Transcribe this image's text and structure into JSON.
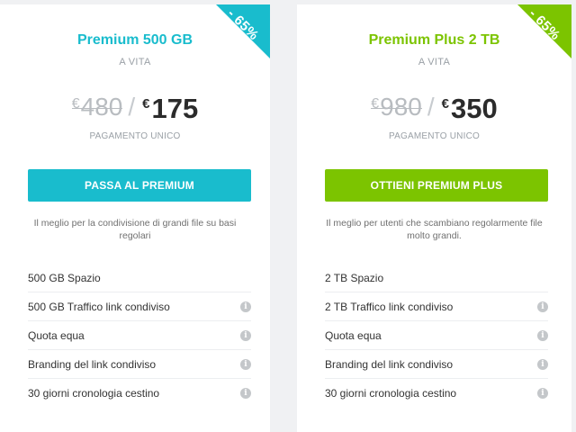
{
  "plans": [
    {
      "title": "Premium 500 GB",
      "subtitle": "A VITA",
      "discount": "- 65%",
      "old_price_currency": "€",
      "old_price": "480",
      "new_price_currency": "€",
      "new_price": "175",
      "payment_label": "PAGAMENTO UNICO",
      "cta_label": "PASSA AL PREMIUM",
      "description": "Il meglio per la condivisione di grandi file su basi regolari",
      "accent_color": "#19bccd",
      "features": [
        {
          "label": "500 GB Spazio",
          "info": false
        },
        {
          "label": "500 GB Traffico link condiviso",
          "info": true
        },
        {
          "label": "Quota equa",
          "info": true
        },
        {
          "label": "Branding del link condiviso",
          "info": true
        },
        {
          "label": "30 giorni cronologia cestino",
          "info": true
        }
      ]
    },
    {
      "title": "Premium Plus 2 TB",
      "subtitle": "A VITA",
      "discount": "- 65%",
      "old_price_currency": "€",
      "old_price": "980",
      "new_price_currency": "€",
      "new_price": "350",
      "payment_label": "PAGAMENTO UNICO",
      "cta_label": "OTTIENI PREMIUM PLUS",
      "description": "Il meglio per utenti che scambiano regolarmente file molto grandi.",
      "accent_color": "#7cc400",
      "features": [
        {
          "label": "2 TB Spazio",
          "info": false
        },
        {
          "label": "2 TB Traffico link condiviso",
          "info": true
        },
        {
          "label": "Quota equa",
          "info": true
        },
        {
          "label": "Branding del link condiviso",
          "info": true
        },
        {
          "label": "30 giorni cronologia cestino",
          "info": true
        }
      ]
    }
  ],
  "icons": {
    "info": "info-icon"
  }
}
